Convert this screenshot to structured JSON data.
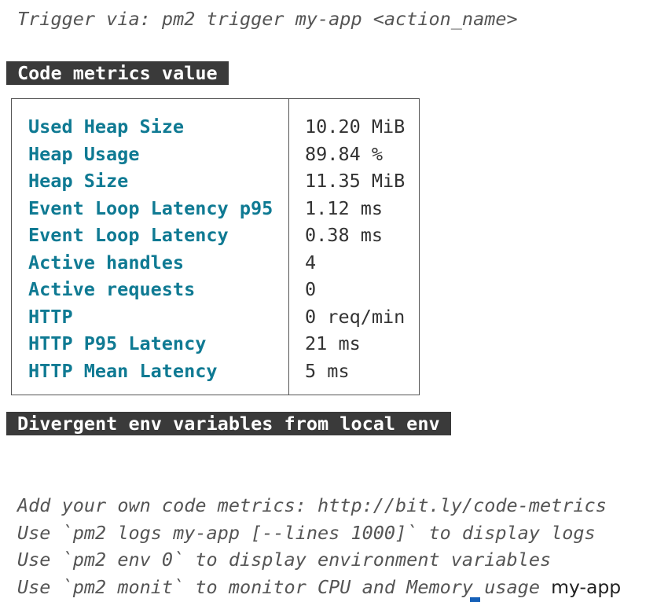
{
  "terminal": {
    "trigger_line": "Trigger via: pm2 trigger my-app <action_name>",
    "code_metrics_header": "Code metrics value",
    "metrics": [
      {
        "name": "Used Heap Size",
        "value": "10.20 MiB"
      },
      {
        "name": "Heap Usage",
        "value": "89.84 %"
      },
      {
        "name": "Heap Size",
        "value": "11.35 MiB"
      },
      {
        "name": "Event Loop Latency p95",
        "value": "1.12 ms"
      },
      {
        "name": "Event Loop Latency",
        "value": "0.38 ms"
      },
      {
        "name": "Active handles",
        "value": "4"
      },
      {
        "name": "Active requests",
        "value": "0"
      },
      {
        "name": "HTTP",
        "value": "0 req/min"
      },
      {
        "name": "HTTP P95 Latency",
        "value": "21 ms"
      },
      {
        "name": "HTTP Mean Latency",
        "value": "5 ms"
      }
    ],
    "divergent_env_header": "Divergent env variables from local env",
    "hints": [
      "Add your own code metrics: http://bit.ly/code-metrics",
      "Use `pm2 logs my-app [--lines 1000]` to display logs",
      "Use `pm2 env 0` to display environment variables",
      "Use `pm2 monit` to monitor CPU and Memory usage"
    ],
    "prompt_input": "my-app"
  }
}
